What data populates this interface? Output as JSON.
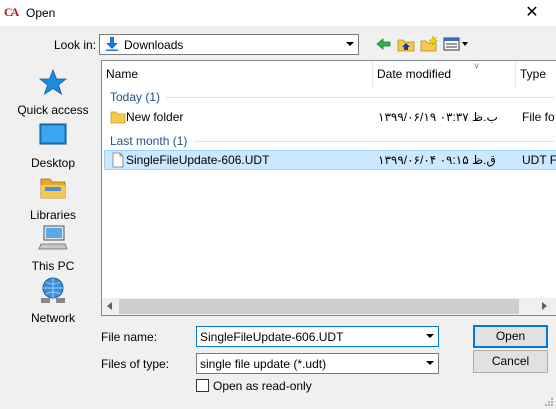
{
  "window": {
    "title": "Open",
    "app_icon_text": "CA"
  },
  "lookin": {
    "label": "Look in:",
    "value": "Downloads"
  },
  "toolbar": [
    "back-arrow-icon",
    "up-folder-icon",
    "new-folder-icon",
    "view-menu-icon"
  ],
  "places": [
    {
      "label": "Quick access",
      "icon": "star-icon"
    },
    {
      "label": "Desktop",
      "icon": "desktop-icon"
    },
    {
      "label": "Libraries",
      "icon": "libraries-icon"
    },
    {
      "label": "This PC",
      "icon": "computer-icon"
    },
    {
      "label": "Network",
      "icon": "network-icon"
    }
  ],
  "columns": {
    "name": "Name",
    "date": "Date modified",
    "type": "Type"
  },
  "groups": [
    {
      "label": "Today (1)",
      "items": [
        {
          "name": "New folder",
          "date": "۱۳۹۹/۰۶/۱۹ ب.ظ ۰۳:۳۷",
          "type": "File fo",
          "icon": "folder-icon",
          "selected": false
        }
      ]
    },
    {
      "label": "Last month (1)",
      "items": [
        {
          "name": "SingleFileUpdate-606.UDT",
          "date": "۱۳۹۹/۰۶/۰۴ ق.ظ ۰۹:۱۵",
          "type": "UDT Fi",
          "icon": "file-icon",
          "selected": true
        }
      ]
    }
  ],
  "form": {
    "filename_label": "File name:",
    "filename_value": "SingleFileUpdate-606.UDT",
    "filetype_label": "Files of type:",
    "filetype_value": "single file update (*.udt)",
    "readonly_label": "Open as read-only",
    "readonly_checked": false
  },
  "buttons": {
    "open": "Open",
    "cancel": "Cancel"
  },
  "colors": {
    "selection": "#cce8ff",
    "group_header": "#1e4f91",
    "accent": "#0078d7",
    "app_icon": "#c8141e"
  }
}
